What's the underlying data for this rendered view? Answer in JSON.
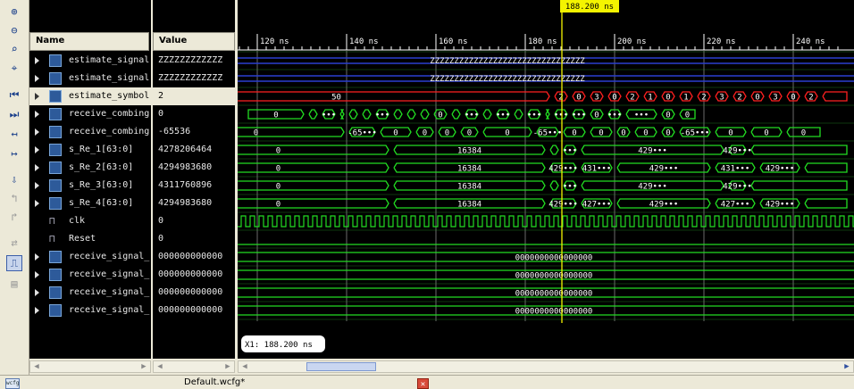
{
  "toolbar": {
    "icons": [
      "zoom-in-icon",
      "zoom-out-icon",
      "zoom-fit-icon",
      "zoom-full-icon",
      "zoom-cursor-icon",
      "go-to-start-icon",
      "go-to-end-icon",
      "previous-transition-icon",
      "next-transition-icon",
      "add-marker-icon",
      "previous-marker-icon",
      "next-marker-icon",
      "swap-cursor-icon",
      "snap-transition-icon",
      "floating-ruler-icon"
    ]
  },
  "headers": {
    "name": "Name",
    "value": "Value"
  },
  "signals": [
    {
      "name": "estimate_signal",
      "value": "ZZZZZZZZZZZZ",
      "icon": "bus-icon",
      "expandable": true
    },
    {
      "name": "estimate_signal",
      "value": "ZZZZZZZZZZZZ",
      "icon": "bus-icon",
      "expandable": true
    },
    {
      "name": "estimate_symbol",
      "value": "2",
      "icon": "bus-icon",
      "expandable": true,
      "selected": true
    },
    {
      "name": "receive_combing",
      "value": "0",
      "icon": "bus-icon",
      "expandable": true
    },
    {
      "name": "receive_combing",
      "value": "-65536",
      "icon": "bus-icon",
      "expandable": true
    },
    {
      "name": "s_Re_1[63:0]",
      "value": "4278206464",
      "icon": "bus-icon",
      "expandable": true
    },
    {
      "name": "s_Re_2[63:0]",
      "value": "4294983680",
      "icon": "bus-icon",
      "expandable": true
    },
    {
      "name": "s_Re_3[63:0]",
      "value": "4311760896",
      "icon": "bus-icon",
      "expandable": true
    },
    {
      "name": "s_Re_4[63:0]",
      "value": "4294983680",
      "icon": "bus-icon",
      "expandable": true
    },
    {
      "name": "clk",
      "value": "0",
      "icon": "bit-icon",
      "expandable": false
    },
    {
      "name": "Reset",
      "value": "0",
      "icon": "bit-icon",
      "expandable": false
    },
    {
      "name": "receive_signal_",
      "value": "000000000000",
      "icon": "bus-icon",
      "expandable": true
    },
    {
      "name": "receive_signal_",
      "value": "000000000000",
      "icon": "bus-icon",
      "expandable": true
    },
    {
      "name": "receive_signal_",
      "value": "000000000000",
      "icon": "bus-icon",
      "expandable": true
    },
    {
      "name": "receive_signal_",
      "value": "000000000000",
      "icon": "bus-icon",
      "expandable": true
    }
  ],
  "timeline": {
    "labels": [
      "120 ns",
      "140 ns",
      "160 ns",
      "180 ns",
      "200 ns",
      "220 ns",
      "240 ns"
    ],
    "tick_values_ns": [
      120,
      140,
      160,
      180,
      200,
      220,
      240
    ]
  },
  "cursor": {
    "time_ns": 188.2,
    "label": "188.200 ns",
    "readout": "X1: 188.200 ns"
  },
  "waveforms": {
    "z_value": "ZZZZZZZZZZZZZZZZZZZZZZZZZZZZZZZZ",
    "symbol_segments": [
      "50",
      "2",
      "0",
      "3",
      "0",
      "2",
      "1",
      "0",
      "1",
      "2",
      "3",
      "2",
      "0",
      "3",
      "0",
      "2"
    ],
    "combing1_labels": [
      "0",
      "•••",
      "•••",
      "0",
      "•••",
      "•••",
      "•••",
      "0",
      "•••",
      "•••",
      "0",
      "•••",
      "•••",
      "0",
      "•••",
      "•••",
      "•••",
      "0",
      "•••",
      "•••",
      "0",
      "•••",
      "•••",
      "0",
      "0"
    ],
    "combing2_labels": [
      "0",
      "-65•••",
      "0",
      "0",
      "0",
      "0",
      "0",
      "-65•••",
      "0",
      "0",
      "0",
      "0",
      "0",
      "-65•••",
      "0",
      "0",
      "0"
    ],
    "re1_labels": [
      "0",
      "16384",
      "429•••",
      "•••",
      "429•••",
      "429•••"
    ],
    "re2_labels": [
      "0",
      "16384",
      "429•••",
      "431•••",
      "429•••",
      "431•••",
      "429•••"
    ],
    "re3_labels": [
      "0",
      "16384",
      "429•••",
      "•••",
      "429•••",
      "429•••"
    ],
    "re4_labels": [
      "0",
      "16384",
      "429•••",
      "427•••",
      "429•••",
      "427•••",
      "429•••"
    ],
    "receive_value": "0000000000000000"
  },
  "tab": {
    "title": "Default.wcfg*",
    "close": "✕",
    "icon_text": "wcfg"
  },
  "colors": {
    "green": "#22dd22",
    "red": "#ff2020",
    "blue": "#2a3fd0",
    "cursor": "#f4f400",
    "background": "#000000"
  }
}
